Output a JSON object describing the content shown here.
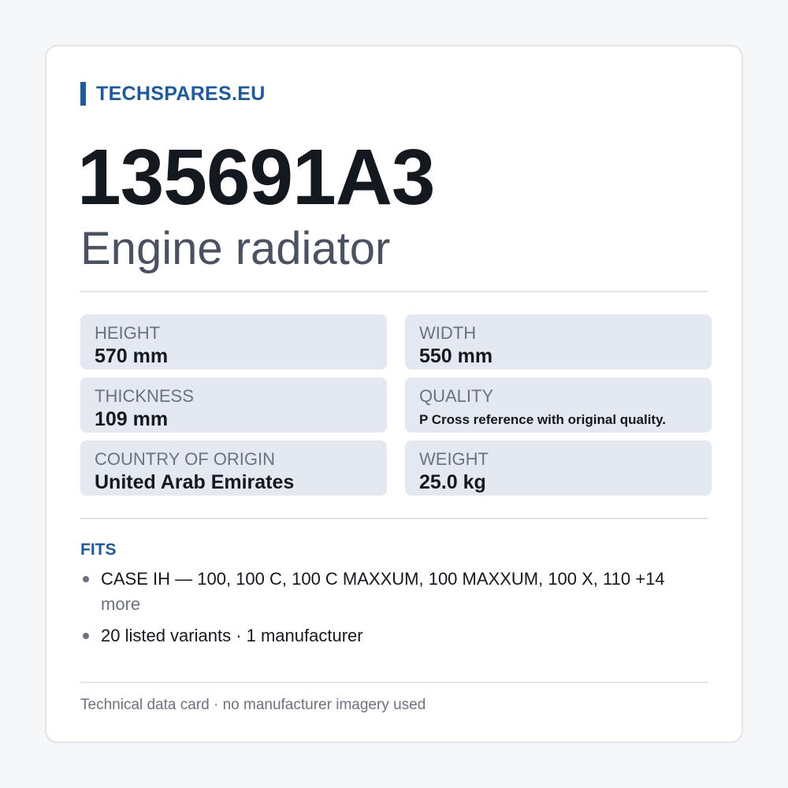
{
  "brand": {
    "name": "TECHSPARES.EU",
    "accent_color": "#1a5aa6"
  },
  "part": {
    "number": "135691A3",
    "name": "Engine radiator"
  },
  "specs": [
    {
      "label": "HEIGHT",
      "value": "570 mm"
    },
    {
      "label": "WIDTH",
      "value": "550 mm"
    },
    {
      "label": "THICKNESS",
      "value": "109 mm"
    },
    {
      "label": "QUALITY",
      "value": "P Cross reference with original quality."
    },
    {
      "label": "COUNTRY OF ORIGIN",
      "value": "United Arab Emirates"
    },
    {
      "label": "WEIGHT",
      "value": "25.0 kg"
    }
  ],
  "fits": {
    "title": "FITS",
    "items": [
      {
        "text": "CASE IH — 100, 100 C, 100 C MAXXUM, 100 MAXXUM, 100 X, 110 +14",
        "more": "more"
      },
      {
        "text": "20 listed variants · 1 manufacturer"
      }
    ]
  },
  "footer": {
    "note": "Technical data card · no manufacturer imagery used"
  }
}
